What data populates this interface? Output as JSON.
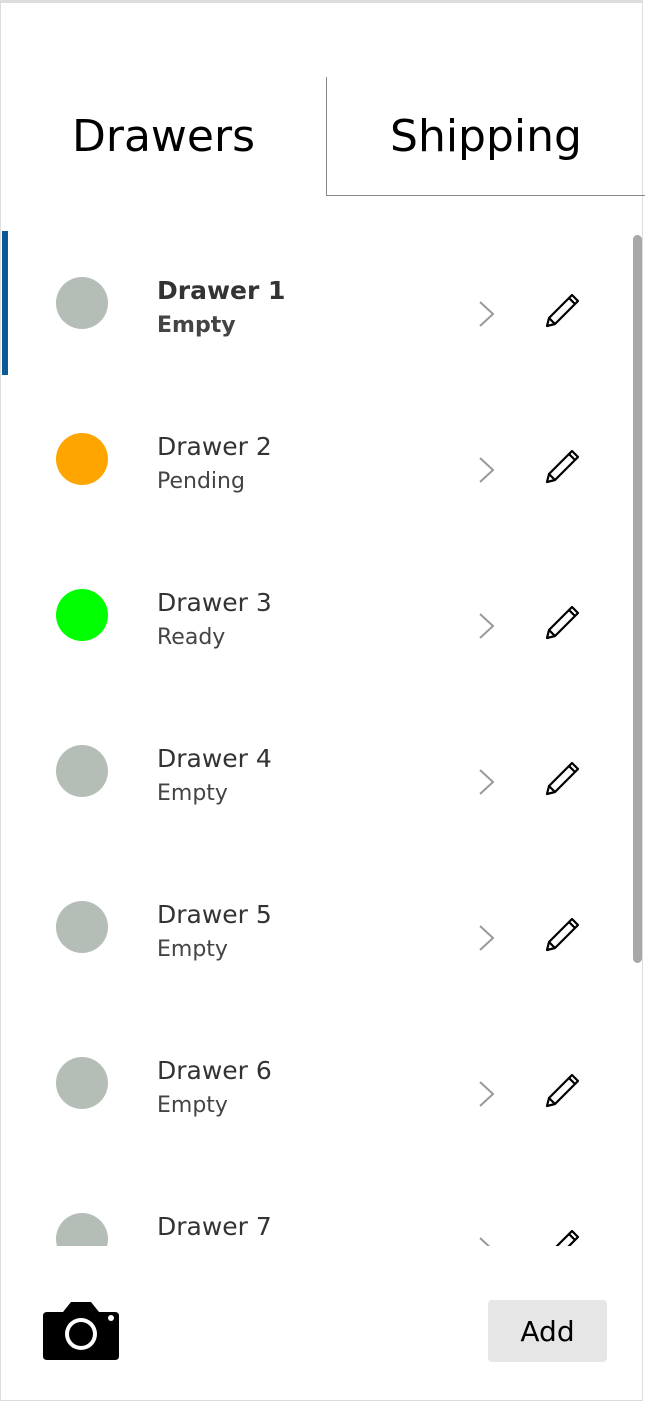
{
  "tabs": {
    "drawers": "Drawers",
    "shipping": "Shipping"
  },
  "drawers": [
    {
      "name": "Drawer 1",
      "status": "Empty",
      "status_color": "#b4bdb6",
      "selected": true
    },
    {
      "name": "Drawer 2",
      "status": "Pending",
      "status_color": "#ffa500",
      "selected": false
    },
    {
      "name": "Drawer 3",
      "status": "Ready",
      "status_color": "#00ff00",
      "selected": false
    },
    {
      "name": "Drawer 4",
      "status": "Empty",
      "status_color": "#b4bdb6",
      "selected": false
    },
    {
      "name": "Drawer 5",
      "status": "Empty",
      "status_color": "#b4bdb6",
      "selected": false
    },
    {
      "name": "Drawer 6",
      "status": "Empty",
      "status_color": "#b4bdb6",
      "selected": false
    },
    {
      "name": "Drawer 7",
      "status": "",
      "status_color": "#b4bdb6",
      "selected": false
    }
  ],
  "icons": {
    "row_arrow": "chevron-right-icon",
    "row_edit": "pencil-icon",
    "capture": "camera-icon"
  },
  "actions": {
    "add_label": "Add"
  },
  "colors": {
    "selection_accent": "#0b5a96"
  }
}
